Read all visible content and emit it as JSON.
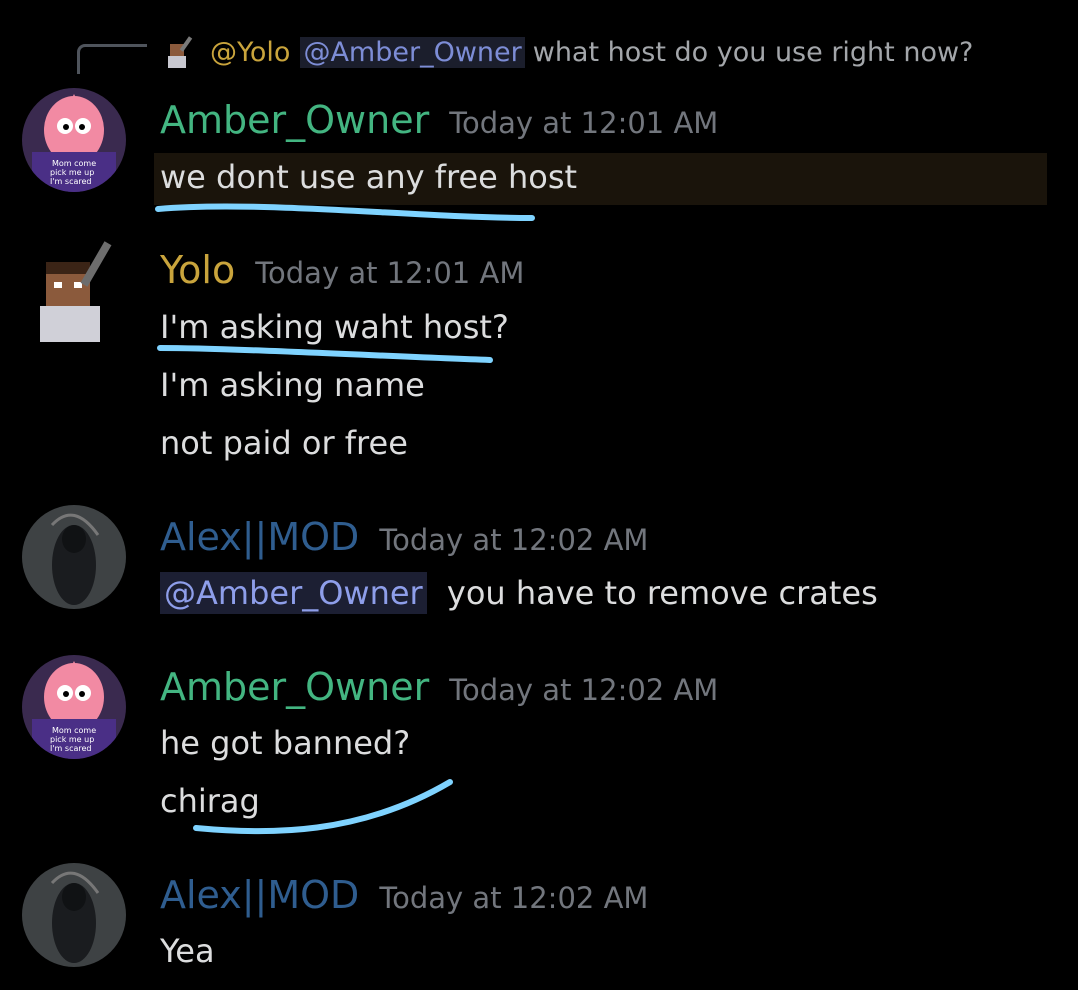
{
  "reply": {
    "author": "@Yolo",
    "mention": "@Amber_Owner",
    "text": "what host do you use right now?"
  },
  "users": {
    "amber": {
      "name": "Amber_Owner",
      "color": "#43b581"
    },
    "yolo": {
      "name": "Yolo",
      "color": "#c9a43c"
    },
    "alex": {
      "name": "Alex||MOD",
      "color": "#2f5d8f"
    }
  },
  "avatar_text": {
    "line1": "Mom come",
    "line2": "pick me up",
    "line3": "I'm scared"
  },
  "messages": [
    {
      "author": "Amber_Owner",
      "timestamp": "Today at 12:01 AM",
      "lines": [
        "we dont use any free host"
      ]
    },
    {
      "author": "Yolo",
      "timestamp": "Today at 12:01 AM",
      "lines": [
        "I'm asking waht host?",
        "I'm asking name",
        "not paid or free"
      ]
    },
    {
      "author": "Alex||MOD",
      "timestamp": "Today at 12:02 AM",
      "mention": "@Amber_Owner",
      "lines": [
        "you have to remove crates"
      ]
    },
    {
      "author": "Amber_Owner",
      "timestamp": "Today at 12:02 AM",
      "lines": [
        "he got banned?",
        "chirag"
      ]
    },
    {
      "author": "Alex||MOD",
      "timestamp": "Today at 12:02 AM",
      "lines": [
        "Yea"
      ]
    }
  ],
  "colors": {
    "background": "#000000",
    "timestamp": "#72767d",
    "mention": "#8e9eea",
    "annotation_stroke": "#7fd3ff"
  }
}
